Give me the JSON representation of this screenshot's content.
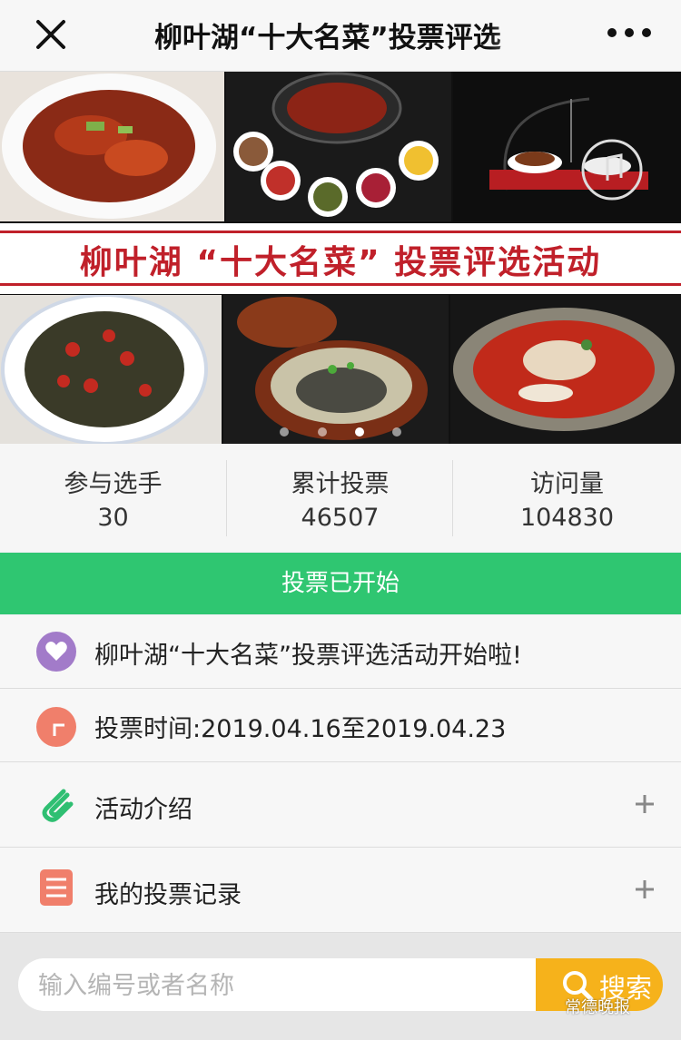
{
  "nav": {
    "title": "柳叶湖“十大名菜”投票评选",
    "close_icon": "close-icon",
    "more_icon": "more-icon"
  },
  "banner": {
    "caption": "柳叶湖 “十大名菜” 投票评选活动",
    "dot_count": 4,
    "active_dot": 3
  },
  "stats": [
    {
      "label": "参与选手",
      "value": "30"
    },
    {
      "label": "累计投票",
      "value": "46507"
    },
    {
      "label": "访问量",
      "value": "104830"
    }
  ],
  "vote_status": "投票已开始",
  "rows": {
    "announcement": "柳叶湖“十大名菜”投票评选活动开始啦!",
    "vote_time": "投票时间:2019.04.16至2019.04.23",
    "intro": "活动介绍",
    "my_votes": "我的投票记录"
  },
  "search": {
    "placeholder": "输入编号或者名称",
    "button": "搜索"
  },
  "watermark": "常德晚报",
  "colors": {
    "accent_green": "#2fc671",
    "search_orange": "#f6b21b",
    "heart_purple": "#a27bc9",
    "clock_red": "#f07f6b",
    "clip_green": "#2fbf72",
    "list_red": "#f07f6b"
  }
}
